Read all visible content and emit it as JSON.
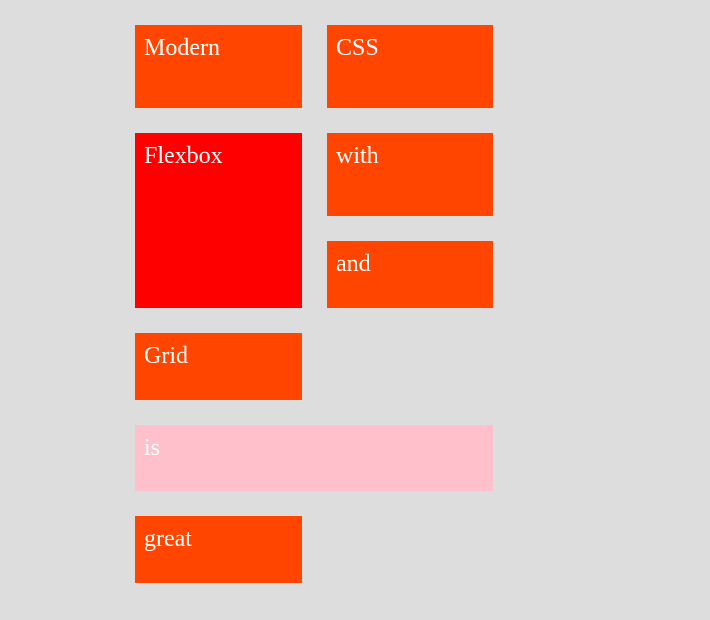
{
  "colors": {
    "page_background": "#dddddd",
    "box_default": "#ff4500",
    "box_emphasis": "#ff0000",
    "box_light": "#ffc0cb",
    "text": "#ffffff"
  },
  "boxes": [
    {
      "label": "Modern",
      "color": "#ff4500"
    },
    {
      "label": "CSS",
      "color": "#ff4500"
    },
    {
      "label": "Flexbox",
      "color": "#ff0000"
    },
    {
      "label": "with",
      "color": "#ff4500"
    },
    {
      "label": "and",
      "color": "#ff4500"
    },
    {
      "label": "Grid",
      "color": "#ff4500"
    },
    {
      "label": "is",
      "color": "#ffc0cb"
    },
    {
      "label": "great",
      "color": "#ff4500"
    }
  ]
}
